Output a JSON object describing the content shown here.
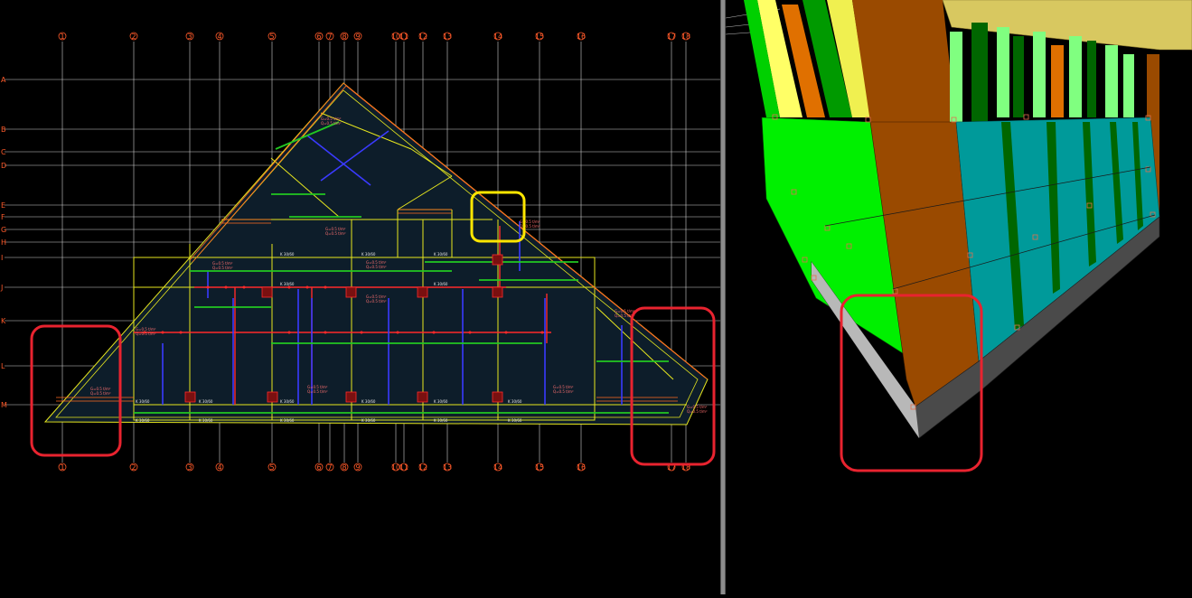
{
  "plan": {
    "axis_numbers": [
      "1",
      "2",
      "3",
      "4",
      "5",
      "6",
      "7",
      "8",
      "9",
      "10",
      "11",
      "12",
      "13",
      "14",
      "15",
      "16",
      "17",
      "18"
    ],
    "row_letters": [
      "A",
      "B",
      "C",
      "D",
      "E",
      "F",
      "G",
      "H",
      "I",
      "J",
      "K",
      "L",
      "M"
    ],
    "load_text_1": "G=0.5 t/m²",
    "load_text_2": "Q=0.5 t/m²",
    "beam_label": "K 30/60"
  },
  "colors": {
    "grid": "#cfcfcf",
    "slab_outline": "#e6e61e",
    "beam_red": "#ff2a2a",
    "beam_blue": "#3a3aff",
    "beam_green": "#22c822",
    "slab_fill": "#0d1d2a",
    "highlight_red": "#e8232f",
    "highlight_yellow": "#ffe600",
    "axis_orange": "#ff5a2a"
  },
  "view3d": {
    "panel_colors": [
      "#00f000",
      "#9a4a00",
      "#009a9a",
      "#ffff66",
      "#006600",
      "#80ff80",
      "#e07000"
    ]
  }
}
